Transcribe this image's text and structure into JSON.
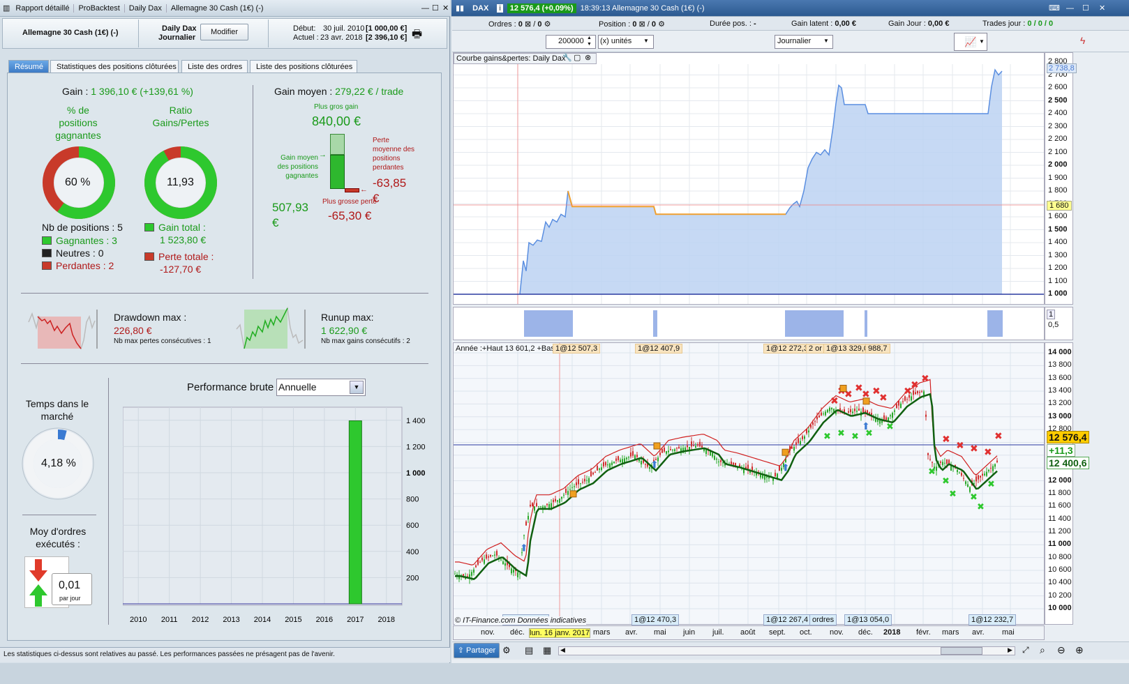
{
  "left": {
    "title_tabs": [
      "Rapport détaillé",
      "ProBacktest",
      "Daily Dax",
      "Allemagne 30 Cash (1€) (-)"
    ],
    "header": {
      "instrument": "Allemagne 30 Cash (1€) (-)",
      "system_name": "Daily Dax",
      "timeframe": "Journalier",
      "modify_label": "Modifier",
      "start_label": "Début:",
      "start_date": "30 juil. 2010",
      "start_value": "[1 000,00 €]",
      "current_label": "Actuel :",
      "current_date": "23 avr. 2018",
      "current_value": "[2 396,10 €]"
    },
    "tabs": [
      "Résumé",
      "Statistiques des positions clôturées",
      "Liste des ordres",
      "Liste des positions clôturées"
    ],
    "summary": {
      "gain_label": "Gain : ",
      "gain_value": "1 396,10 € (+139,61 %)",
      "pct_winning_label": "% de positions gagnantes",
      "pct_winning_value": "60 %",
      "pct_winning": 0.6,
      "ratio_label": "Ratio Gains/Pertes",
      "ratio_value": "11,93",
      "ratio_fill": 0.92,
      "nb_positions": "Nb de positions : 5",
      "winners": "Gagnantes : 3",
      "neutral": "Neutres : 0",
      "losers": "Perdantes : 2",
      "gain_total_label": "Gain total :",
      "gain_total_value": "1 523,80 €",
      "loss_total_label": "Perte totale :",
      "loss_total_value": "-127,70 €",
      "avg_gain_label": "Gain moyen : ",
      "avg_gain_value": "279,22 € / trade",
      "biggest_gain_label": "Plus gros gain",
      "biggest_gain_value": "840,00 €",
      "avg_win_label": "Gain moyen des positions gagnantes",
      "avg_win_value": "507,93 €",
      "avg_loss_label": "Perte moyenne des positions perdantes",
      "avg_loss_value": "-63,85 €",
      "biggest_loss_label": "Plus grosse perte",
      "biggest_loss_value": "-65,30 €",
      "drawdown_label": "Drawdown max :",
      "drawdown_value": "226,80 €",
      "drawdown_consec": "Nb max pertes consécutives : 1",
      "runup_label": "Runup max:",
      "runup_value": "1 622,90 €",
      "runup_consec": "Nb max gains consécutifs : 2",
      "time_market_label": "Temps dans le marché",
      "time_market_value": "4,18 %",
      "time_market_frac": 0.0418,
      "orders_label": "Moy d'ordres exécutés :",
      "orders_value": "0,01",
      "orders_unit": "par jour"
    },
    "perf": {
      "title": "Performance brute",
      "select": "Annuelle",
      "years": [
        "2010",
        "2011",
        "2012",
        "2013",
        "2014",
        "2015",
        "2016",
        "2017",
        "2018"
      ],
      "values": [
        0,
        0,
        0,
        0,
        0,
        0,
        0,
        1396.1,
        0
      ],
      "yticks": [
        "1 400",
        "1 200",
        "1 000",
        "800",
        "600",
        "400",
        "200"
      ]
    },
    "footer": "Les statistiques ci-dessus sont relatives au passé. Les performances passées ne présagent pas de l'avenir."
  },
  "right": {
    "title": {
      "symbol": "DAX",
      "price": "12 576,4 (+0,09%)",
      "time_title": "18:39:13 Allemagne 30 Cash (1€) (-)"
    },
    "toolbar": {
      "orders_label": "Ordres :",
      "orders_a": "0",
      "orders_b": "0",
      "position_label": "Position :",
      "position_a": "0",
      "position_b": "0",
      "duration_label": "Durée pos. :",
      "duration_value": "-",
      "latent_label": "Gain latent :",
      "latent_value": "0,00 €",
      "day_label": "Gain Jour :",
      "day_value": "0,00 €",
      "trades_label": "Trades jour :",
      "trades_value": "0 / 0 / 0",
      "qty": "200000",
      "unit": "(x) unités",
      "period": "Journalier"
    },
    "equity": {
      "title": "Courbe gains&pertes: Daily Dax",
      "yticks": [
        "2 800",
        "2 700",
        "2 600",
        "2 500",
        "2 400",
        "2 300",
        "2 200",
        "2 100",
        "2 000",
        "1 900",
        "1 800",
        "1 700",
        "1 600",
        "1 500",
        "1 400",
        "1 300",
        "1 200",
        "1 100",
        "1 000"
      ],
      "last": "2 738,8",
      "cursor": "1 680"
    },
    "position_panel": {
      "ytick_top": "1",
      "ytick_mid": "0,5"
    },
    "price_chart": {
      "legend": "Année :+Haut 13 601,2 +Bas 11 692,3",
      "yticks": [
        "14 000",
        "13 800",
        "13 600",
        "13 400",
        "13 200",
        "13 000",
        "12 800",
        "12 600",
        "12 400",
        "12 200",
        "12 000",
        "11 800",
        "11 600",
        "11 400",
        "11 200",
        "11 000",
        "10 800",
        "10 600",
        "10 400",
        "10 200",
        "10 000"
      ],
      "last_price": "12 576,4",
      "change": "+11,3",
      "ma_value": "12 400,6",
      "top_tags": [
        "1@12 507,3",
        "1@12 407,9",
        "1@12 272,3",
        "2 or",
        "1@13 329,0",
        "988,7"
      ],
      "bottom_tags": [
        "1@11 928,4",
        "1@12 470,3",
        "1@12 267,4",
        "ordres",
        "1@13 054,0",
        "1@12 232,7"
      ],
      "copyright": "© IT-Finance.com Données indicatives",
      "xlabels": [
        "nov.",
        "déc.",
        "lun. 16 janv. 2017",
        "mars",
        "avr.",
        "mai",
        "juin",
        "juil.",
        "août",
        "sept.",
        "oct.",
        "nov.",
        "déc.",
        "2018",
        "févr.",
        "mars",
        "avr.",
        "mai"
      ]
    },
    "bottom": {
      "share_label": "Partager"
    }
  }
}
